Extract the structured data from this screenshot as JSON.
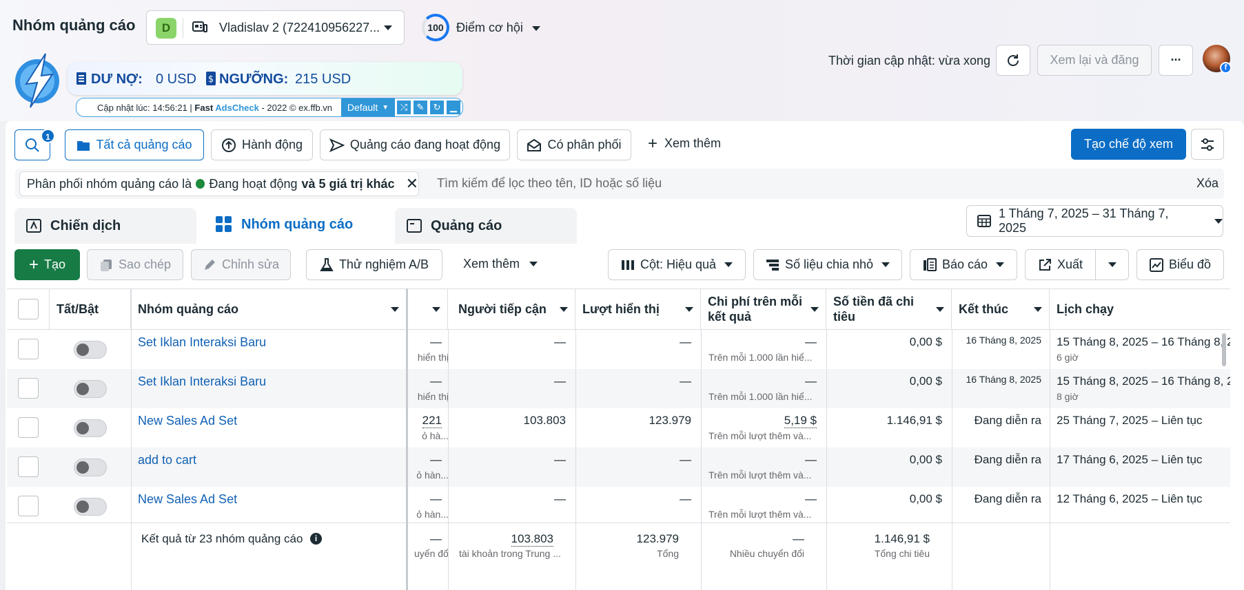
{
  "header": {
    "title": "Nhóm quảng cáo",
    "account_badge": "D",
    "account_name": "Vladislav 2 (722410956227...",
    "score": "100",
    "opportunity_label": "Điểm cơ hội",
    "update_time": "Thời gian cập nhật: vừa xong",
    "review_button": "Xem lại và đăng",
    "more_button": "···"
  },
  "extension": {
    "debt_label": "DƯ NỢ:",
    "debt_value": "0 USD",
    "threshold_label": "NGƯỠNG:",
    "threshold_value": "215 USD",
    "update_prefix": "Cập nhật lúc: 14:56:21 | ",
    "brand_bold": "Fast ",
    "brand_name": "AdsCheck",
    "copyright": " - 2022 © ex.ffb.vn",
    "preset": "Default"
  },
  "viewbar": {
    "search_count": "1",
    "views": [
      "Tất cả quảng cáo",
      "Hành động",
      "Quảng cáo đang hoạt động",
      "Có phân phối"
    ],
    "more": "Xem thêm",
    "create_view": "Tạo chế độ xem"
  },
  "filter": {
    "chip_text": "Phân phối nhóm quảng cáo là",
    "chip_status": "Đang hoạt động",
    "chip_more": "và 5 giá trị khác",
    "search_placeholder": "Tìm kiếm để lọc theo tên, ID hoặc số liệu",
    "clear": "Xóa"
  },
  "tabs": [
    "Chiến dịch",
    "Nhóm quảng cáo",
    "Quảng cáo"
  ],
  "date_range": "1 Tháng 7, 2025 – 31 Tháng 7, 2025",
  "toolbar": {
    "create": "Tạo",
    "duplicate": "Sao chép",
    "edit": "Chỉnh sửa",
    "ab_test": "Thử nghiệm A/B",
    "more": "Xem thêm",
    "columns": "Cột: Hiệu quả",
    "breakdown": "Số liệu chia nhỏ",
    "reports": "Báo cáo",
    "export": "Xuất",
    "charts": "Biểu đồ"
  },
  "columns": [
    "Tất/Bật",
    "Nhóm quảng cáo",
    "Người tiếp cận",
    "Lượt hiển thị",
    "Chi phí trên mỗi kết quả",
    "Số tiền đã chi tiêu",
    "Kết thúc",
    "Lịch chạy"
  ],
  "rows": [
    {
      "name": "Set Iklan Interaksi Baru",
      "res": "—",
      "res_sub": "hiển thị",
      "reach": "—",
      "impr": "—",
      "cpr": "—",
      "cpr_sub": "Trên mỗi 1.000 lần hiể...",
      "spent": "0,00 $",
      "end": "16 Tháng 8, 2025",
      "schedule": "15 Tháng 8, 2025 – 16 Tháng 8, 2",
      "sched_sub": "6 giờ"
    },
    {
      "name": "Set Iklan Interaksi Baru",
      "res": "—",
      "res_sub": "hiển thị",
      "reach": "—",
      "impr": "—",
      "cpr": "—",
      "cpr_sub": "Trên mỗi 1.000 lần hiể...",
      "spent": "0,00 $",
      "end": "16 Tháng 8, 2025",
      "schedule": "15 Tháng 8, 2025 – 16 Tháng 8, 2",
      "sched_sub": "8 giờ"
    },
    {
      "name": "New Sales Ad Set",
      "res": "221",
      "res_sub": "ỏ hà...",
      "reach": "103.803",
      "impr": "123.979",
      "cpr": "5,19 $",
      "cpr_sub": "Trên mỗi lượt thêm và...",
      "spent": "1.146,91 $",
      "end": "Đang diễn ra",
      "schedule": "25 Tháng 7, 2025 – Liên tục",
      "sched_sub": ""
    },
    {
      "name": "add to cart",
      "res": "—",
      "res_sub": "ỏ hàn...",
      "reach": "—",
      "impr": "—",
      "cpr": "—",
      "cpr_sub": "Trên mỗi lượt thêm và...",
      "spent": "0,00 $",
      "end": "Đang diễn ra",
      "schedule": "17 Tháng 6, 2025 – Liên tục",
      "sched_sub": ""
    },
    {
      "name": "New Sales Ad Set",
      "res": "—",
      "res_sub": "ỏ hàn...",
      "reach": "—",
      "impr": "—",
      "cpr": "—",
      "cpr_sub": "Trên mỗi lượt thêm và...",
      "spent": "0,00 $",
      "end": "Đang diễn ra",
      "schedule": "12 Tháng 6, 2025 – Liên tục",
      "sched_sub": ""
    }
  ],
  "summary": {
    "label": "Kết quả từ 23 nhóm quảng cáo",
    "res": "—",
    "res_sub": "uyển đổi",
    "reach": "103.803",
    "reach_sub": "tài khoản trong Trung ...",
    "impr": "123.979",
    "impr_sub": "Tổng",
    "cpr": "—",
    "cpr_sub": "Nhiều chuyển đổi",
    "spent": "1.146,91 $",
    "spent_sub": "Tổng chi tiêu"
  }
}
